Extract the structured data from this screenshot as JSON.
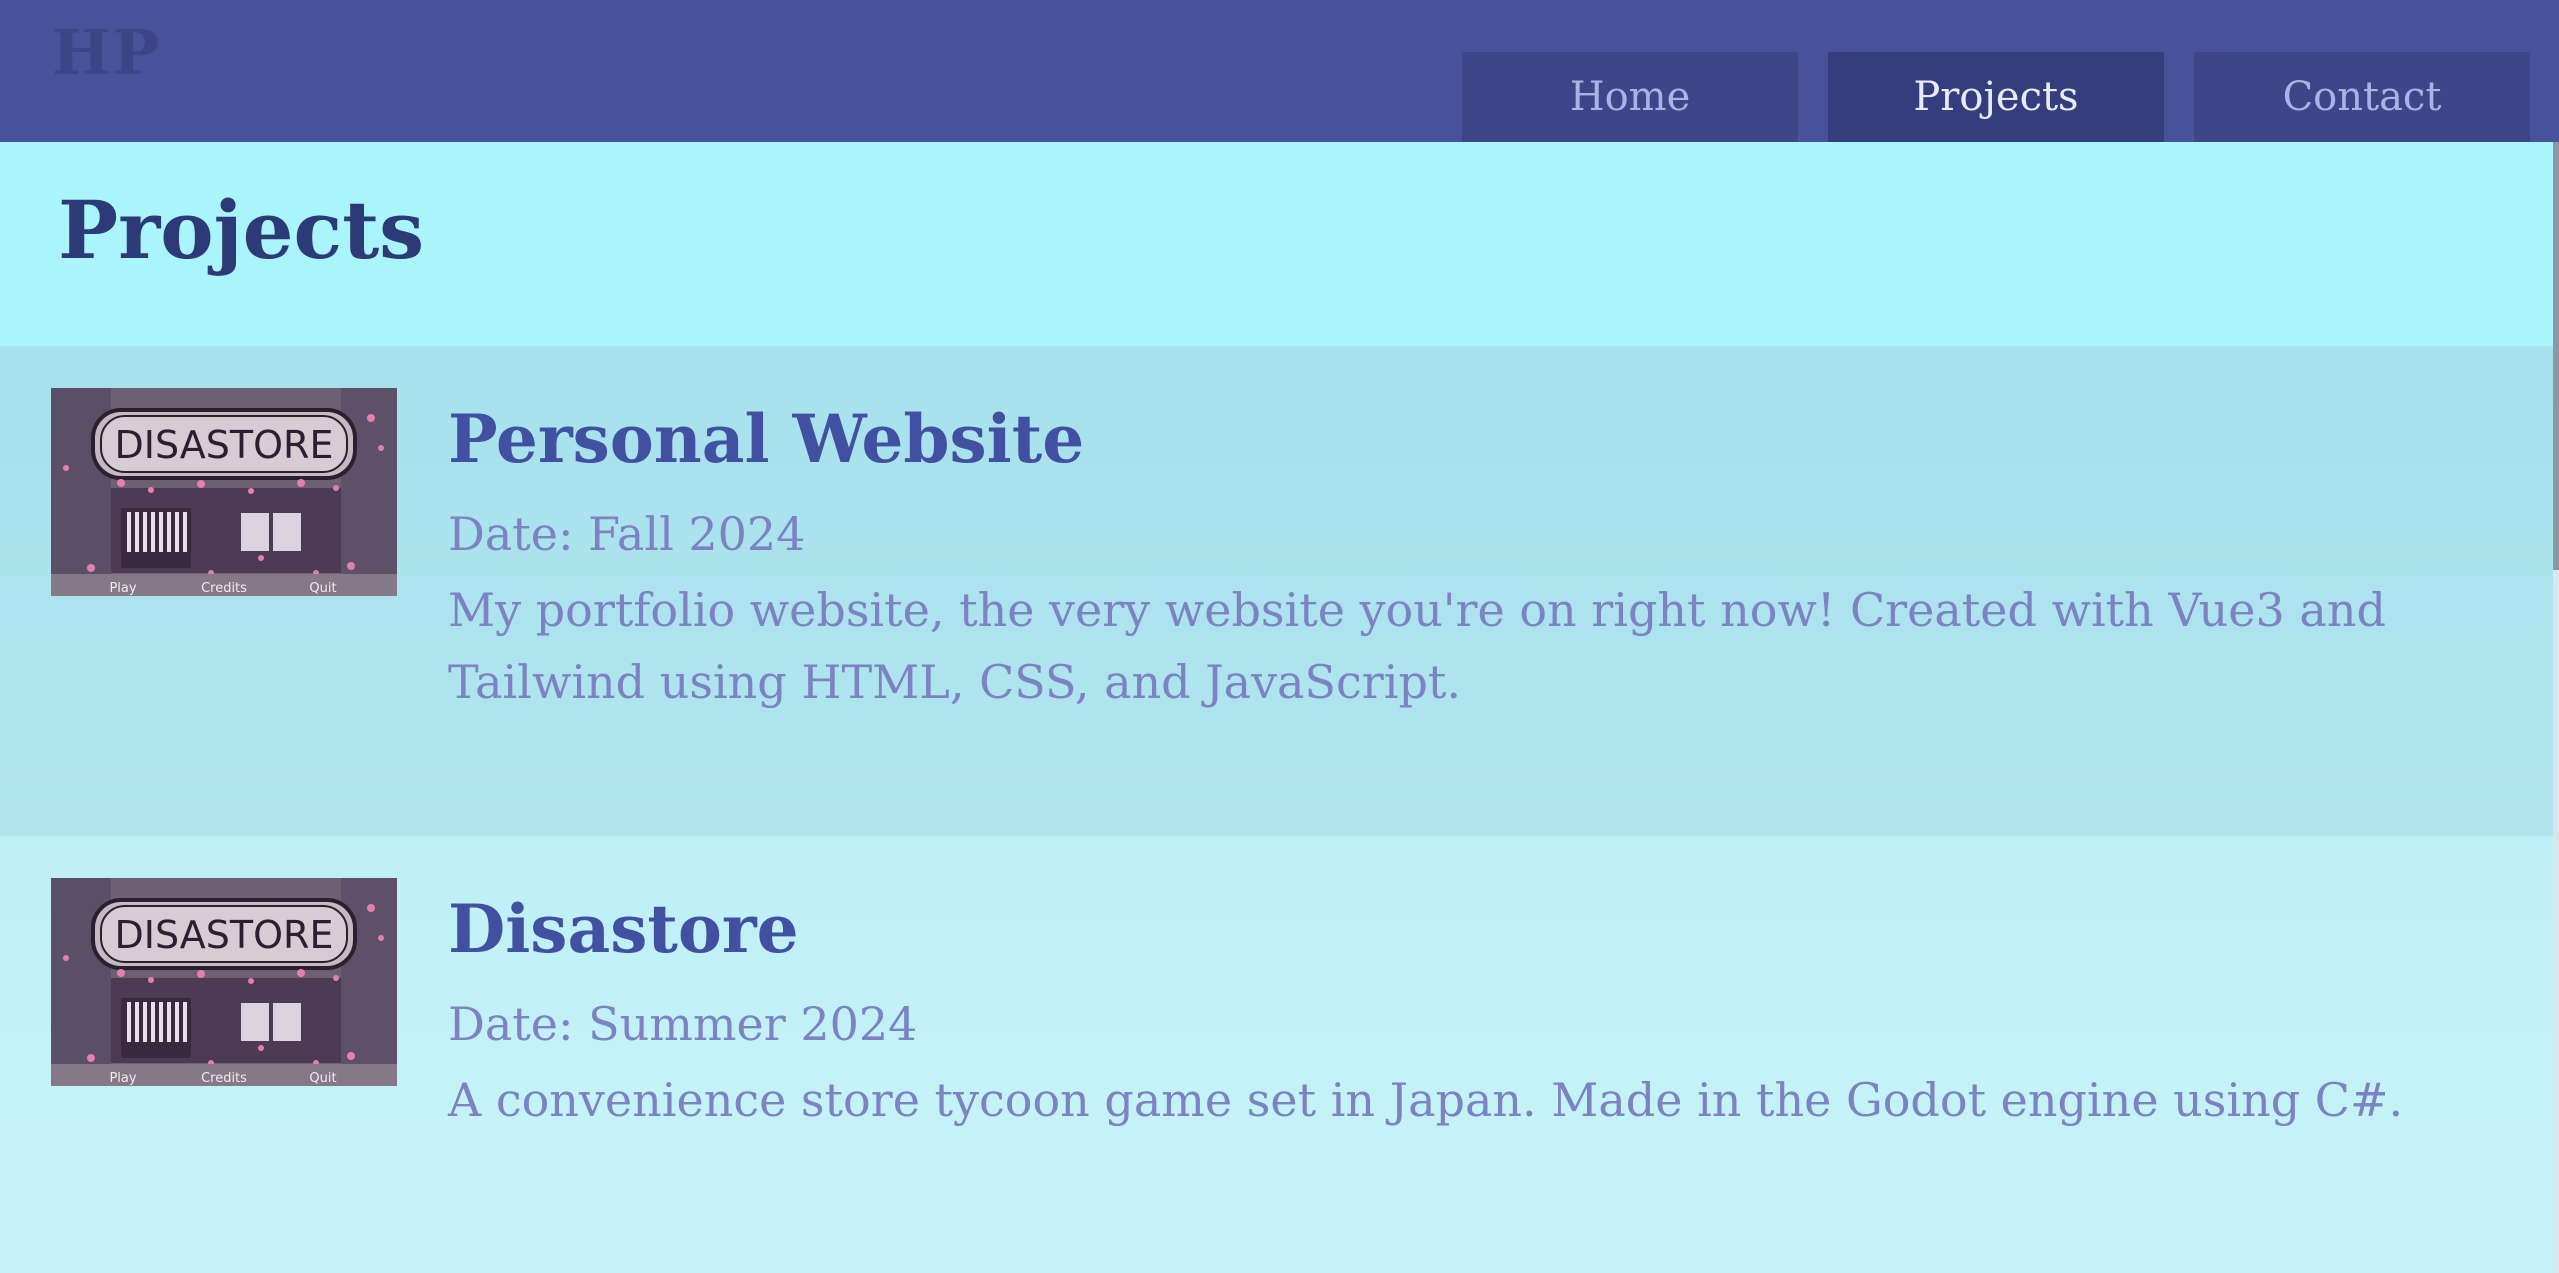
{
  "logo": "HP",
  "nav": {
    "items": [
      {
        "label": "Home"
      },
      {
        "label": "Projects"
      },
      {
        "label": "Contact"
      }
    ]
  },
  "page": {
    "title": "Projects"
  },
  "projects": [
    {
      "title": "Personal Website",
      "date": "Date: Fall 2024",
      "description": "My portfolio website, the very website you're on right now! Created with Vue3 and Tailwind using HTML, CSS, and JavaScript.",
      "thumb": {
        "sign": "DISASTORE",
        "menu": [
          "Play",
          "Credits",
          "Quit"
        ]
      }
    },
    {
      "title": "Disastore",
      "date": "Date: Summer 2024",
      "description": "A convenience store tycoon game set in Japan. Made in the Godot engine using C#.",
      "thumb": {
        "sign": "DISASTORE",
        "menu": [
          "Play",
          "Credits",
          "Quit"
        ]
      }
    }
  ],
  "colors": {
    "navbar": "#465299",
    "nav_button": "#3c4689",
    "nav_active": "#343e7c",
    "header_band": "#aaf4fb",
    "title": "#2c3a78",
    "project_title": "#4150a0",
    "body_text": "#7c82c2"
  }
}
